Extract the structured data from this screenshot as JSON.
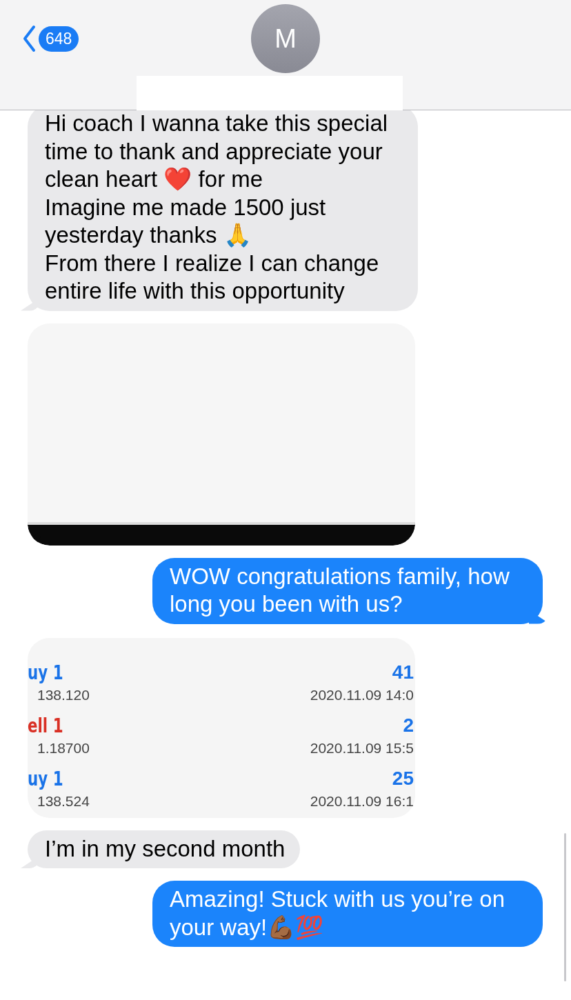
{
  "header": {
    "back_count": "648",
    "avatar_initial": "M"
  },
  "messages": [
    {
      "kind": "text",
      "outgoing": false,
      "tail": true,
      "text": "Hi coach I wanna take this special time to thank and appreciate your clean heart ❤️ for me\nImagine me made 1500 just yesterday thanks 🙏\nFrom there I realize I can change entire life with this opportunity"
    },
    {
      "kind": "image",
      "tail": true
    },
    {
      "kind": "text",
      "outgoing": true,
      "tail": true,
      "text": "WOW congratulations family, how long you been with us?"
    },
    {
      "kind": "trades",
      "rows": [
        {
          "type": "uy 1",
          "color": "#1a73e8",
          "price": "138.120",
          "profit": "41",
          "time": "2020.11.09 14:0"
        },
        {
          "type": "ell 1",
          "color": "#d93025",
          "price": "1.18700",
          "profit": "2",
          "time": "2020.11.09 15:5"
        },
        {
          "type": "uy 1",
          "color": "#1a73e8",
          "price": "138.524",
          "profit": "25",
          "time": "2020.11.09 16:1"
        }
      ]
    },
    {
      "kind": "text",
      "outgoing": false,
      "tail": true,
      "text": "I’m in my second month"
    },
    {
      "kind": "text",
      "outgoing": true,
      "tail": false,
      "text": "Amazing! Stuck with us you’re on your way!💪🏾💯"
    }
  ]
}
